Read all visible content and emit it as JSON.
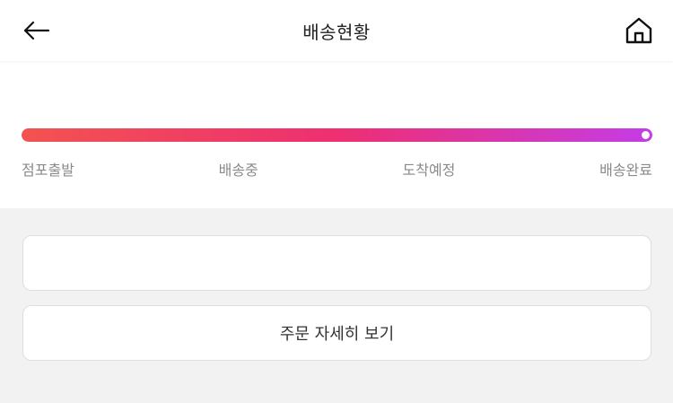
{
  "header": {
    "title": "배송현황",
    "back_icon": "arrow-left-icon",
    "home_icon": "home-icon"
  },
  "progress": {
    "value": 1.0,
    "steps": [
      "점포출발",
      "배송중",
      "도착예정",
      "배송완료"
    ],
    "colors": {
      "start": "#f25350",
      "mid": "#ee2f72",
      "end": "#c53ce6"
    }
  },
  "actions": {
    "detail_label": "주문 자세히 보기"
  }
}
